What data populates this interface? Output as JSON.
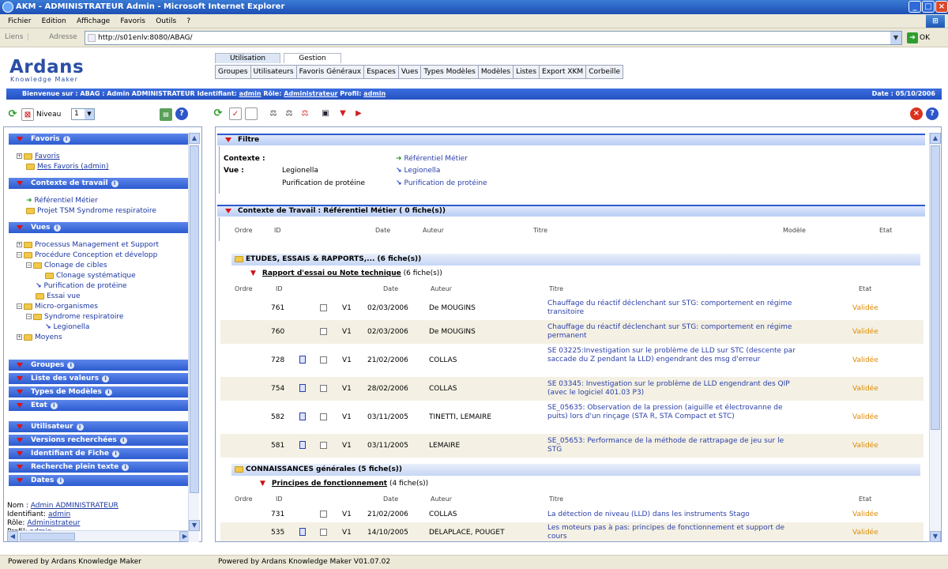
{
  "window": {
    "title": "AKM - ADMINISTRATEUR Admin - Microsoft Internet Explorer"
  },
  "menubar": [
    "Fichier",
    "Edition",
    "Affichage",
    "Favoris",
    "Outils",
    "?"
  ],
  "address": {
    "links_label": "Liens",
    "label": "Adresse",
    "url": "http://s01enlv:8080/ABAG/",
    "go": "OK"
  },
  "app": {
    "logo": "Ardans",
    "logo_sub": "Knowledge Maker",
    "tabs": [
      "Utilisation",
      "Gestion"
    ],
    "nav": [
      "Groupes",
      "Utilisateurs",
      "Favoris Généraux",
      "Espaces",
      "Vues",
      "Types Modèles",
      "Modèles",
      "Listes",
      "Export XKM",
      "Corbeille"
    ]
  },
  "welcome": {
    "prefix": "Bienvenue sur : ABAG : Admin ADMINISTRATEUR",
    "id_label": "Identifiant:",
    "id_value": "admin",
    "role_label": "Rôle:",
    "role_value": "Administrateur",
    "profil_label": "Profil:",
    "profil_value": "admin",
    "date": "Date : 05/10/2006"
  },
  "left_toolbar": {
    "niveau_label": "Niveau",
    "niveau_value": "1"
  },
  "left": {
    "favoris": {
      "title": "Favoris",
      "items": [
        "Favoris",
        "Mes Favoris (admin)"
      ]
    },
    "contexte": {
      "title": "Contexte de travail",
      "items": [
        "Référentiel Métier",
        "Projet TSM Syndrome respiratoire"
      ]
    },
    "vues": {
      "title": "Vues",
      "items": [
        "Processus Management et Support",
        "Procédure Conception et développ",
        "Clonage de cibles",
        "Clonage systématique",
        "Purification de protéine",
        "Essai vue",
        "Micro-organismes",
        "Syndrome respiratoire",
        "Legionella",
        "Moyens"
      ]
    },
    "sections": [
      "Groupes",
      "Liste des valeurs",
      "Types de Modèles",
      "Etat",
      "Utilisateur",
      "Versions recherchées",
      "Identifiant de Fiche",
      "Recherche plein texte",
      "Dates"
    ],
    "user_info": {
      "nom_label": "Nom :",
      "nom": "Admin ADMINISTRATEUR",
      "id_label": "Identifiant:",
      "id": "admin",
      "role_label": "Rôle:",
      "role": "Administrateur",
      "profil_label": "Profil:",
      "profil": "admin"
    }
  },
  "filter": {
    "title": "Filtre",
    "contexte_label": "Contexte :",
    "contexte_value": "Référentiel Métier",
    "vue_label": "Vue :",
    "vues": [
      {
        "name": "Legionella",
        "link": "Legionella"
      },
      {
        "name": "Purification de protéine",
        "link": "Purification de protéine"
      }
    ]
  },
  "context_section": {
    "title": "Contexte de Travail : Référentiel Métier ( 0 fiche(s))"
  },
  "columns": {
    "ordre": "Ordre",
    "id": "ID",
    "date": "Date",
    "auteur": "Auteur",
    "titre": "Titre",
    "modele": "Modèle",
    "etat": "Etat"
  },
  "groups": [
    {
      "title": "ETUDES, ESSAIS & RAPPORTS,... (6 fiche(s))",
      "subtitle": "Rapport d'essai ou Note technique",
      "subcount": "(6 fiche(s))",
      "rows": [
        {
          "id": "761",
          "doc": false,
          "version": "V1",
          "date": "02/03/2006",
          "auteur": "De MOUGINS",
          "titre": "Chauffage du réactif déclenchant sur STG: comportement en régime transitoire",
          "etat": "Validée"
        },
        {
          "id": "760",
          "doc": false,
          "version": "V1",
          "date": "02/03/2006",
          "auteur": "De MOUGINS",
          "titre": "Chauffage du réactif déclenchant sur STG: comportement en régime permanent",
          "etat": "Validée"
        },
        {
          "id": "728",
          "doc": true,
          "version": "V1",
          "date": "21/02/2006",
          "auteur": "COLLAS",
          "titre": "SE 03225:Investigation sur le problème de LLD sur STC (descente par saccade du Z pendant la LLD) engendrant des msg d'erreur",
          "etat": "Validée"
        },
        {
          "id": "754",
          "doc": true,
          "version": "V1",
          "date": "28/02/2006",
          "auteur": "COLLAS",
          "titre": "SE 03345: Investigation sur le problème de LLD engendrant des QIP (avec le logiciel 401.03 P3)",
          "etat": "Validée"
        },
        {
          "id": "582",
          "doc": true,
          "version": "V1",
          "date": "03/11/2005",
          "auteur": "TINETTI, LEMAIRE",
          "titre": "SE_05635: Observation de la pression (aiguille et électrovanne de puits) lors d'un rinçage (STA R, STA Compact et STC)",
          "etat": "Validée"
        },
        {
          "id": "581",
          "doc": true,
          "version": "V1",
          "date": "03/11/2005",
          "auteur": "LEMAIRE",
          "titre": "SE_05653: Performance de la méthode de rattrapage de jeu sur le STG",
          "etat": "Validée"
        }
      ]
    },
    {
      "title": "CONNAISSANCES générales (5 fiche(s))",
      "subtitle": "Principes de fonctionnement",
      "subcount": "(4 fiche(s))",
      "rows": [
        {
          "id": "731",
          "doc": false,
          "version": "V1",
          "date": "21/02/2006",
          "auteur": "COLLAS",
          "titre": "La détection de niveau (LLD) dans les instruments Stago",
          "etat": "Validée"
        },
        {
          "id": "535",
          "doc": true,
          "version": "V1",
          "date": "14/10/2005",
          "auteur": "DELAPLACE, POUGET",
          "titre": "Les moteurs pas à pas: principes de fonctionnement et support de cours",
          "etat": "Validée"
        }
      ]
    }
  ],
  "footer": {
    "left": "Powered by Ardans Knowledge Maker",
    "right": "Powered by Ardans Knowledge Maker V01.07.02"
  }
}
